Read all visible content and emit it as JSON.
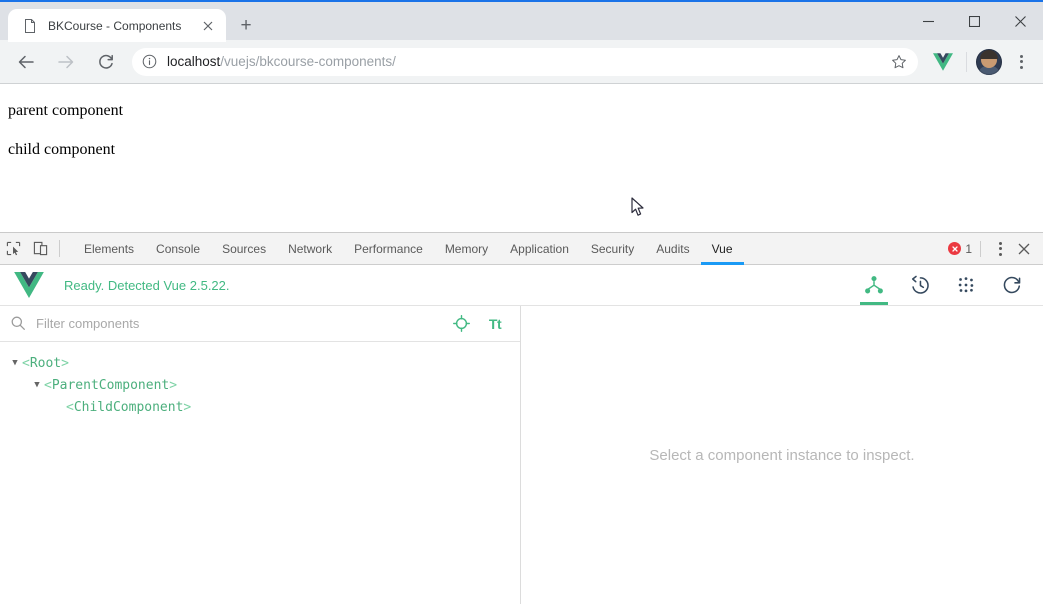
{
  "browser": {
    "tab": {
      "title": "BKCourse - Components",
      "favicon_icon": "page-icon",
      "close_icon": "close-icon"
    },
    "new_tab_label": "+",
    "window_controls": {
      "minimize_icon": "minimize-icon",
      "maximize_icon": "maximize-icon",
      "close_icon": "close-icon"
    },
    "toolbar": {
      "back_icon": "back-arrow-icon",
      "forward_icon": "forward-arrow-icon",
      "reload_icon": "reload-icon",
      "site_info_icon": "info-circle-icon",
      "url_host": "localhost",
      "url_path": "/vuejs/bkcourse-components/",
      "url_full": "localhost/vuejs/bkcourse-components/",
      "bookmark_icon": "star-icon",
      "extension_icon": "vue-extension-icon",
      "avatar_icon": "profile-avatar",
      "menu_icon": "kebab-menu-icon"
    }
  },
  "page": {
    "line1": "parent component",
    "line2": "child component",
    "cursor_icon": "mouse-pointer"
  },
  "devtools": {
    "inspect_icon": "inspect-element-icon",
    "device_icon": "device-toolbar-icon",
    "tabs": [
      {
        "label": "Elements",
        "active": false
      },
      {
        "label": "Console",
        "active": false
      },
      {
        "label": "Sources",
        "active": false
      },
      {
        "label": "Network",
        "active": false
      },
      {
        "label": "Performance",
        "active": false
      },
      {
        "label": "Memory",
        "active": false
      },
      {
        "label": "Application",
        "active": false
      },
      {
        "label": "Security",
        "active": false
      },
      {
        "label": "Audits",
        "active": false
      },
      {
        "label": "Vue",
        "active": true
      }
    ],
    "error_count": "1",
    "error_icon": "error-circle-icon",
    "menu_icon": "kebab-menu-icon",
    "close_icon": "close-icon",
    "accent_color": "#1a9af5"
  },
  "vue_panel": {
    "logo_icon": "vue-logo",
    "status": "Ready. Detected Vue 2.5.22.",
    "status_color": "#42b983",
    "actions": [
      {
        "name": "components-tab-icon",
        "active": true
      },
      {
        "name": "events-history-icon",
        "active": false
      },
      {
        "name": "vuex-dots-icon",
        "active": false
      },
      {
        "name": "refresh-icon",
        "active": false
      }
    ],
    "filter": {
      "search_icon": "search-icon",
      "placeholder": "Filter components",
      "value": "",
      "select_icon": "target-select-icon",
      "text_icon": "Tt"
    },
    "tree": [
      {
        "name": "Root",
        "depth": 0,
        "expandable": true,
        "expanded": true
      },
      {
        "name": "ParentComponent",
        "depth": 1,
        "expandable": true,
        "expanded": true
      },
      {
        "name": "ChildComponent",
        "depth": 2,
        "expandable": false,
        "expanded": false
      }
    ],
    "inspector_empty_message": "Select a component instance to inspect."
  }
}
